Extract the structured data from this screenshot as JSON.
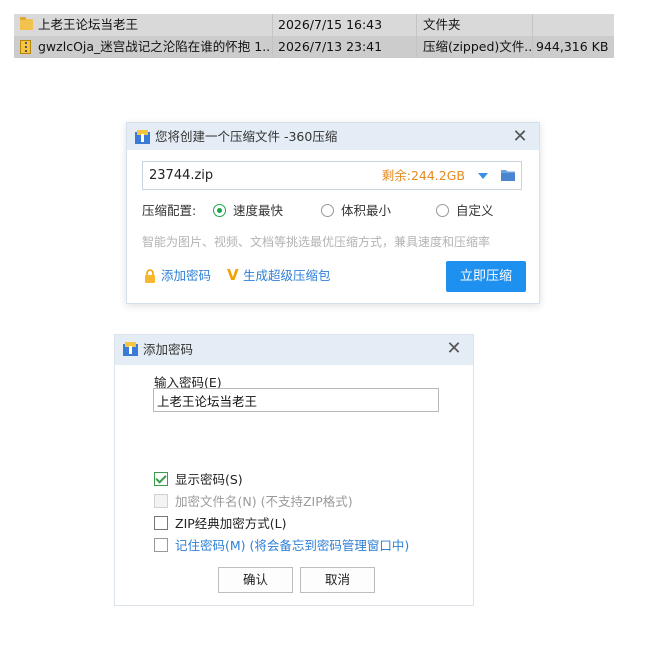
{
  "files": [
    {
      "icon": "folder-icon",
      "name": "上老王论坛当老王",
      "date": "2026/7/15 16:43",
      "type": "文件夹",
      "size": ""
    },
    {
      "icon": "zip-file-icon",
      "name": "gwzlcOja_迷宫战记之沦陷在谁的怀抱 1....",
      "date": "2026/7/13 23:41",
      "type": "压缩(zipped)文件...",
      "size": "944,316 KB"
    }
  ],
  "compress_dialog": {
    "title": "您将创建一个压缩文件 -360压缩",
    "filename": "23744.zip",
    "free_space": "剩余:244.2GB",
    "config_label": "压缩配置:",
    "options": [
      "速度最快",
      "体积最小",
      "自定义"
    ],
    "selected_option": "速度最快",
    "hint": "智能为图片、视频、文档等挑选最优压缩方式，兼具速度和压缩率",
    "add_password": "添加密码",
    "super_compress": "生成超级压缩包",
    "compress_now": "立即压缩"
  },
  "password_dialog": {
    "title": "添加密码",
    "input_label": "输入密码(E)",
    "password_value": "上老王论坛当老王",
    "checkboxes": [
      {
        "label": "显示密码(S)",
        "checked": true,
        "enabled": true
      },
      {
        "label": "加密文件名(N) (不支持ZIP格式)",
        "checked": false,
        "enabled": false
      },
      {
        "label": "ZIP经典加密方式(L)",
        "checked": false,
        "enabled": true
      },
      {
        "label": "记住密码(M) (将会备忘到密码管理窗口中)",
        "checked": false,
        "enabled": true
      }
    ],
    "ok": "确认",
    "cancel": "取消"
  },
  "colors": {
    "accent_blue": "#1e90f0",
    "link_blue": "#2e7fd6",
    "free_space_orange": "#e68a1e",
    "radio_green": "#17a84b",
    "title_bar": "#e4edf6"
  }
}
